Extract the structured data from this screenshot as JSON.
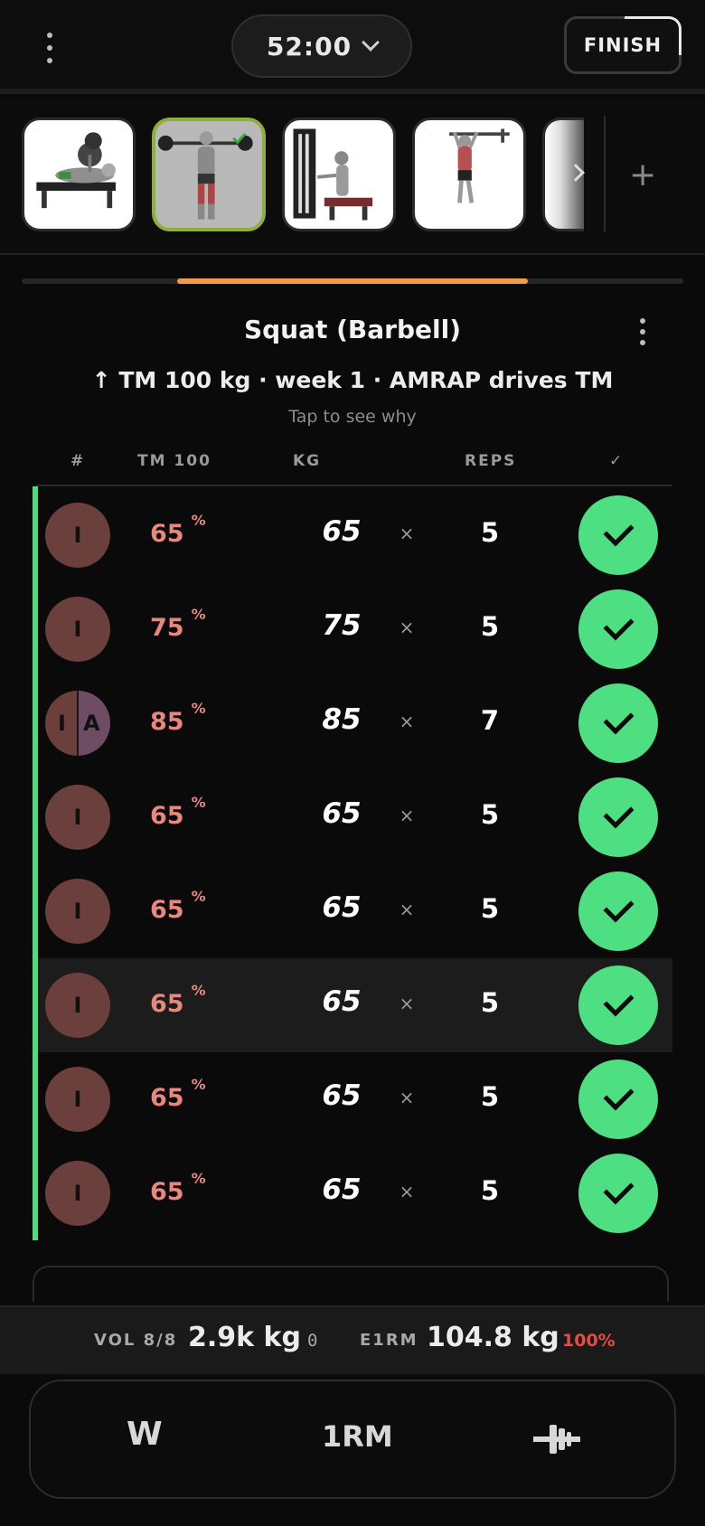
{
  "timer": {
    "value": "52:00"
  },
  "finish_label": "FINISH",
  "exercise": {
    "title": "Squat (Barbell)",
    "tm_line": "↑ TM 100 kg · week 1 · AMRAP drives TM",
    "tap_hint": "Tap to see why"
  },
  "table": {
    "headers": {
      "num": "#",
      "tm": "TM 100",
      "kg": "KG",
      "reps": "REPS",
      "done": "✓"
    },
    "times_symbol": "×",
    "rows": [
      {
        "badge": "I",
        "pct": "65",
        "kg": "65",
        "reps": "5"
      },
      {
        "badge": "I",
        "pct": "75",
        "kg": "75",
        "reps": "5"
      },
      {
        "badge": "I",
        "badge2": "A",
        "pct": "85",
        "kg": "85",
        "reps": "7"
      },
      {
        "badge": "I",
        "pct": "65",
        "kg": "65",
        "reps": "5"
      },
      {
        "badge": "I",
        "pct": "65",
        "kg": "65",
        "reps": "5"
      },
      {
        "badge": "I",
        "pct": "65",
        "kg": "65",
        "reps": "5"
      },
      {
        "badge": "I",
        "pct": "65",
        "kg": "65",
        "reps": "5"
      },
      {
        "badge": "I",
        "pct": "65",
        "kg": "65",
        "reps": "5"
      }
    ],
    "pct_symbol": "%"
  },
  "stats": {
    "vol_label": "VOL 8/8",
    "vol_value": "2.9k kg",
    "vol_extra": "0",
    "e1rm_label": "E1RM",
    "e1rm_value": "104.8 kg",
    "e1rm_pct": "100%"
  },
  "bottom": {
    "w_label": "W",
    "rm_label": "1RM"
  },
  "colors": {
    "accent": "#f29a45",
    "done": "#4ddf82",
    "pct": "#e8877d",
    "warning": "#e44c45"
  }
}
